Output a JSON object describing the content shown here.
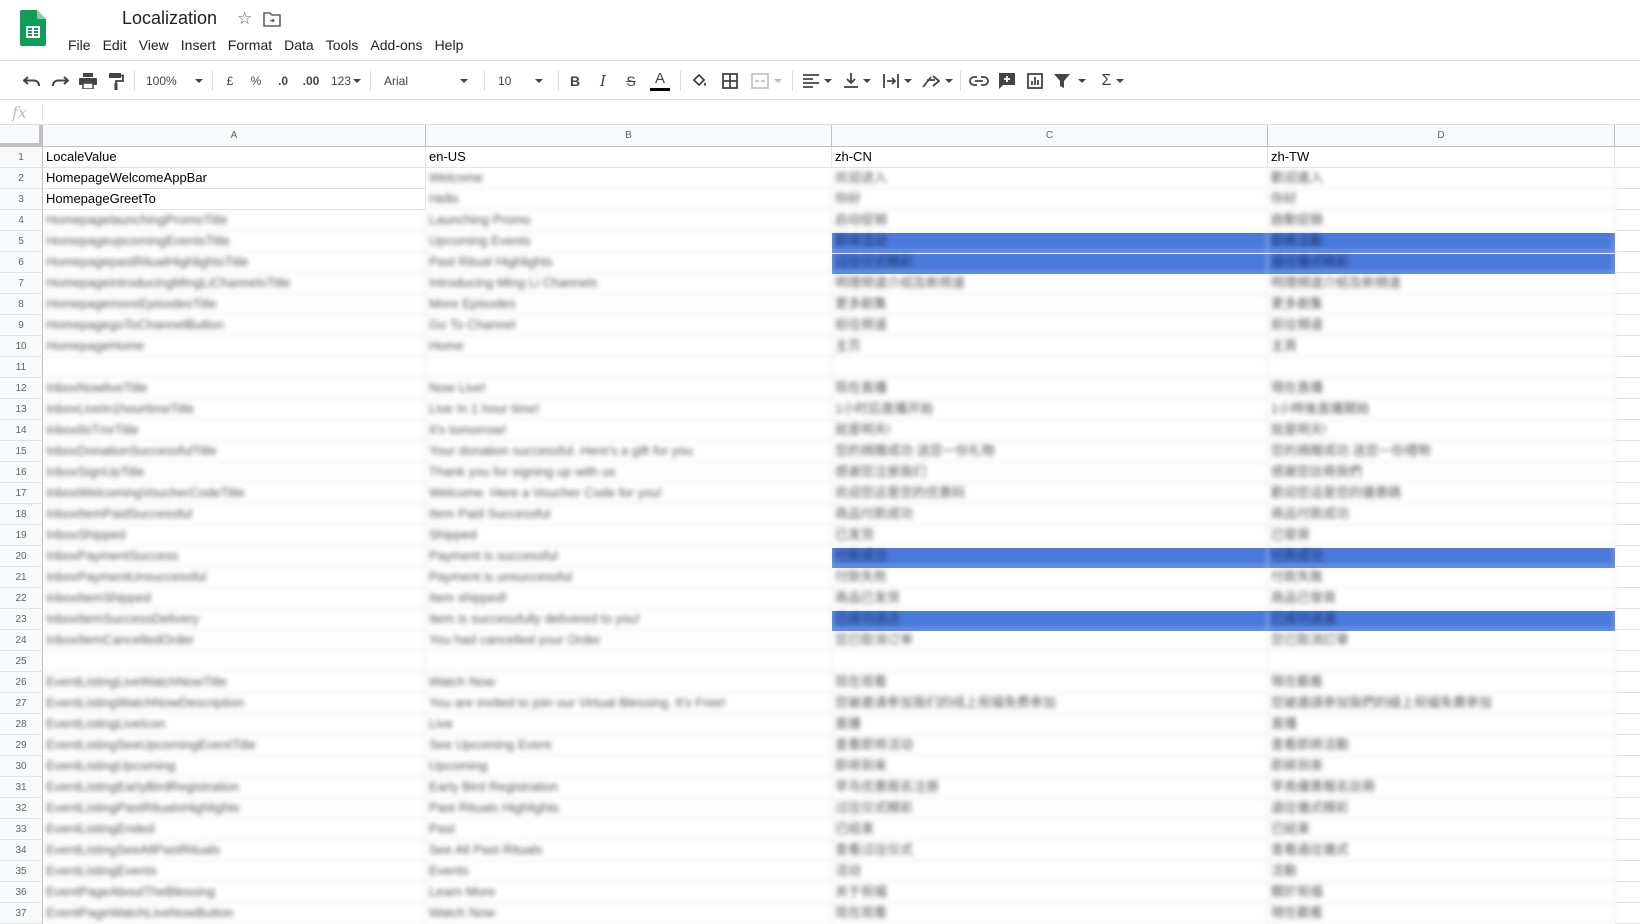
{
  "app": {
    "title": "Localization",
    "brand_color": "#0f9d58"
  },
  "menu": [
    "File",
    "Edit",
    "View",
    "Insert",
    "Format",
    "Data",
    "Tools",
    "Add-ons",
    "Help"
  ],
  "toolbar": {
    "zoom": "100%",
    "currency": "£",
    "percent": "%",
    "decrease_decimal": ".0",
    "increase_decimal": ".00",
    "more_formats": "123",
    "font": "Arial",
    "font_size": "10",
    "bold": "B",
    "italic": "I",
    "strike": "S",
    "text_color_letter": "A"
  },
  "formula_bar": {
    "icon": "fx",
    "value": ""
  },
  "columns": [
    "A",
    "B",
    "C",
    "D"
  ],
  "rows": [
    {
      "n": "1",
      "a": "LocaleValue",
      "b": "en-US",
      "c": "zh-CN",
      "d": "zh-TW",
      "blur": false,
      "hl": false
    },
    {
      "n": "2",
      "a": "HomepageWelcomeAppBar",
      "b": "Welcome",
      "c": "欢迎进入",
      "d": "歡迎進入",
      "blur": false,
      "hl": false
    },
    {
      "n": "3",
      "a": "HomepageGreetTo",
      "b": "Hello",
      "c": "你好",
      "d": "你好",
      "blur": false,
      "hl": false
    },
    {
      "n": "4",
      "a": "HomepagelaunchingPromoTitle",
      "b": "Launching Promo",
      "c": "启动促销",
      "d": "啟動促銷",
      "blur": true,
      "hl": false
    },
    {
      "n": "5",
      "a": "HomepageupcomingEventsTitle",
      "b": "Upcoming Events",
      "c": "即将活动",
      "d": "即將活動",
      "blur": true,
      "hl": true
    },
    {
      "n": "6",
      "a": "HomepagepastRitualHighlightsTitle",
      "b": "Past Ritual Highlights",
      "c": "过往仪式精彩",
      "d": "過往儀式精彩",
      "blur": true,
      "hl": true
    },
    {
      "n": "7",
      "a": "HomepageintroducingMingLiChannelsTitle",
      "b": "Introducing Ming Li Channels",
      "c": "明理频道介绍及新频道",
      "d": "明理頻道介紹及新頻道",
      "blur": true,
      "hl": false
    },
    {
      "n": "8",
      "a": "HomepagemoreEpisodesTitle",
      "b": "More Episodes",
      "c": "更多剧集",
      "d": "更多劇集",
      "blur": true,
      "hl": false
    },
    {
      "n": "9",
      "a": "HomepagegoToChannelButton",
      "b": "Go To Channel",
      "c": "前往频道",
      "d": "前往頻道",
      "blur": true,
      "hl": false
    },
    {
      "n": "10",
      "a": "HomepageHome",
      "b": "Home",
      "c": "主页",
      "d": "主頁",
      "blur": true,
      "hl": false
    },
    {
      "n": "11",
      "a": "",
      "b": "",
      "c": "",
      "d": "",
      "blur": true,
      "hl": false
    },
    {
      "n": "12",
      "a": "InboxNowliveTitle",
      "b": "Now Live!",
      "c": "现在直播",
      "d": "現在直播",
      "blur": true,
      "hl": false
    },
    {
      "n": "13",
      "a": "InboxLiveIn1hourtimeTitle",
      "b": "Live In 1 hour time!",
      "c": "1小时后直播开始",
      "d": "1小時後直播開始",
      "blur": true,
      "hl": false
    },
    {
      "n": "14",
      "a": "InboxItsTmrTitle",
      "b": "It's tomorrow!",
      "c": "就是明天!",
      "d": "就是明天!",
      "blur": true,
      "hl": false
    },
    {
      "n": "15",
      "a": "InboxDonationSuccessfulTitle",
      "b": "Your donation successful. Here's a gift for you",
      "c": "您的捐赠成功 送您一份礼物",
      "d": "您的捐贈成功 送您一份禮物",
      "blur": true,
      "hl": false
    },
    {
      "n": "16",
      "a": "InboxSignUpTitle",
      "b": "Thank you for signing up with us",
      "c": "感谢您注册我们",
      "d": "感謝您註冊我們",
      "blur": true,
      "hl": false
    },
    {
      "n": "17",
      "a": "InboxWelcomingVoucherCodeTitle",
      "b": "Welcome. Here a Voucher Code for you!",
      "c": "欢迎您这是您的优惠码",
      "d": "歡迎您這是您的優惠碼",
      "blur": true,
      "hl": false
    },
    {
      "n": "18",
      "a": "InboxItemPaidSuccessful",
      "b": "Item Paid Successful",
      "c": "商品付款成功",
      "d": "商品付款成功",
      "blur": true,
      "hl": false
    },
    {
      "n": "19",
      "a": "InboxShipped",
      "b": "Shipped",
      "c": "已发货",
      "d": "已發貨",
      "blur": true,
      "hl": false
    },
    {
      "n": "20",
      "a": "InboxPaymentSuccess",
      "b": "Payment is successful",
      "c": "付款成功",
      "d": "付款成功",
      "blur": true,
      "hl": true
    },
    {
      "n": "21",
      "a": "InboxPaymentUnsuccessful",
      "b": "Payment is unsuccessful",
      "c": "付款失败",
      "d": "付款失敗",
      "blur": true,
      "hl": false
    },
    {
      "n": "22",
      "a": "InboxItemShipped",
      "b": "Item shipped!",
      "c": "商品已发货",
      "d": "商品已發貨",
      "blur": true,
      "hl": false
    },
    {
      "n": "23",
      "a": "InboxItemSuccessDelivery",
      "b": "Item is successfully delivered to you!",
      "c": "已成功送达",
      "d": "已成功送達",
      "blur": true,
      "hl": true
    },
    {
      "n": "24",
      "a": "InboxItemCancelledOrder",
      "b": "You had cancelled your Order",
      "c": "您已取消订单",
      "d": "您已取消訂單",
      "blur": true,
      "hl": false
    },
    {
      "n": "25",
      "a": "",
      "b": "",
      "c": "",
      "d": "",
      "blur": true,
      "hl": false
    },
    {
      "n": "26",
      "a": "EventListingLiveWatchNowTitle",
      "b": "Watch Now",
      "c": "现在观看",
      "d": "現在觀看",
      "blur": true,
      "hl": false
    },
    {
      "n": "27",
      "a": "EventListingWatchNowDescription",
      "b": "You are invited to join our Virtual Blessing. It's Free!",
      "c": "您被邀请参加我们的线上祝福免费参加",
      "d": "您被邀請參加我們的線上祝福免費參加",
      "blur": true,
      "hl": false
    },
    {
      "n": "28",
      "a": "EventListingLiveIcon",
      "b": "Live",
      "c": "直播",
      "d": "直播",
      "blur": true,
      "hl": false
    },
    {
      "n": "29",
      "a": "EventListingSeeUpcomingEventTitle",
      "b": "See Upcoming Event",
      "c": "查看即将活动",
      "d": "查看即將活動",
      "blur": true,
      "hl": false
    },
    {
      "n": "30",
      "a": "EventListingUpcoming",
      "b": "Upcoming",
      "c": "即将到来",
      "d": "即將到來",
      "blur": true,
      "hl": false
    },
    {
      "n": "31",
      "a": "EventListingEarlyBirdRegistration",
      "b": "Early Bird Registration",
      "c": "早鸟优惠报名注册",
      "d": "早鳥優惠報名註冊",
      "blur": true,
      "hl": false
    },
    {
      "n": "32",
      "a": "EventListingPastRitualsHighlights",
      "b": "Past Rituals Highlights",
      "c": "过往仪式精彩",
      "d": "過往儀式精彩",
      "blur": true,
      "hl": false
    },
    {
      "n": "33",
      "a": "EventListingEnded",
      "b": "Past",
      "c": "已结束",
      "d": "已結束",
      "blur": true,
      "hl": false
    },
    {
      "n": "34",
      "a": "EventListingSeeAllPastRituals",
      "b": "See All Past Rituals",
      "c": "查看过往仪式",
      "d": "查看過往儀式",
      "blur": true,
      "hl": false
    },
    {
      "n": "35",
      "a": "EventListingEvents",
      "b": "Events",
      "c": "活动",
      "d": "活動",
      "blur": true,
      "hl": false
    },
    {
      "n": "36",
      "a": "EventPageAboutTheBlessing",
      "b": "Learn More",
      "c": "关于祝福",
      "d": "關於祝福",
      "blur": true,
      "hl": false
    },
    {
      "n": "37",
      "a": "EventPageWatchLiveNowButton",
      "b": "Watch Now",
      "c": "现在观看",
      "d": "現在觀看",
      "blur": true,
      "hl": false
    }
  ],
  "colors": {
    "highlight": "#4a7bdc",
    "header_bg": "#f8f9fa",
    "gridline": "#e2e3e3"
  }
}
